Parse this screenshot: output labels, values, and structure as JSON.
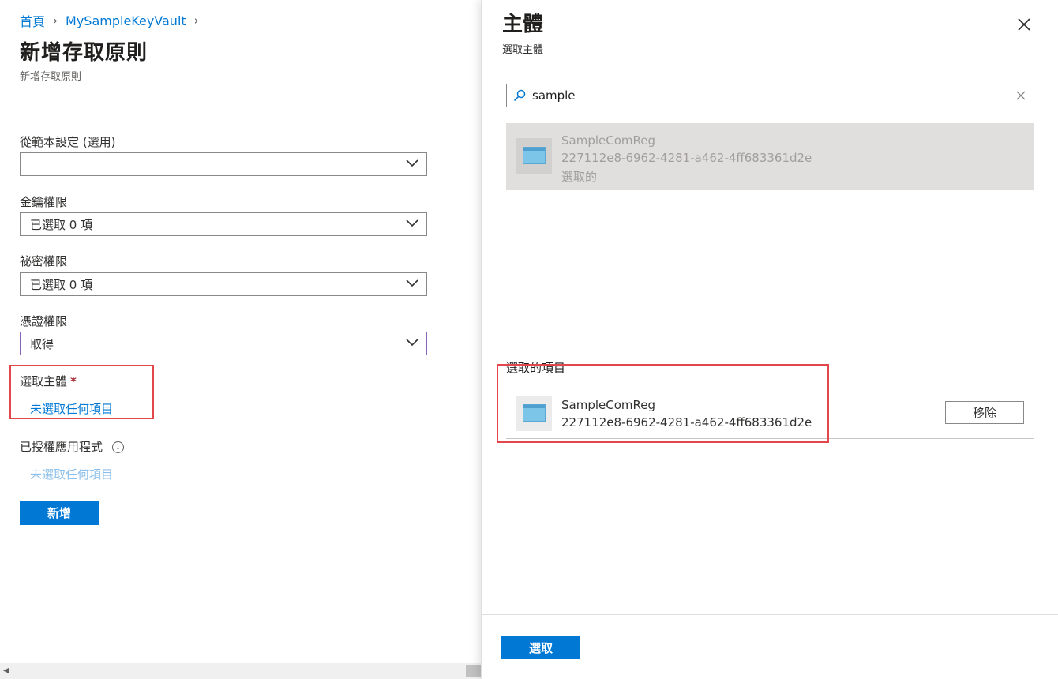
{
  "breadcrumb": {
    "home": "首頁",
    "vault": "MySampleKeyVault"
  },
  "page": {
    "title": "新增存取原則",
    "subtitle": "新增存取原則"
  },
  "form": {
    "template": {
      "label": "從範本設定 (選用)",
      "value": ""
    },
    "key_permissions": {
      "label": "金鑰權限",
      "value": "已選取 0 項"
    },
    "secret_permissions": {
      "label": "祕密權限",
      "value": "已選取 0 項"
    },
    "cert_permissions": {
      "label": "憑證權限",
      "value": "取得"
    },
    "principal": {
      "label": "選取主體",
      "required_mark": "*",
      "link": "未選取任何項目"
    },
    "authorized_app": {
      "label": "已授權應用程式",
      "info": "i",
      "link": "未選取任何項目"
    },
    "add_button": "新增"
  },
  "panel": {
    "title": "主體",
    "subtitle": "選取主體",
    "search": {
      "value": "sample"
    },
    "result": {
      "name": "SampleComReg",
      "id": "227112e8-6962-4281-a462-4ff683361d2e",
      "state": "選取的"
    },
    "selected_heading": "選取的項目",
    "selected_item": {
      "name": "SampleComReg",
      "id": "227112e8-6962-4281-a462-4ff683361d2e",
      "remove_label": "移除"
    },
    "select_button": "選取"
  },
  "colors": {
    "accent": "#0078d4",
    "highlight": "#e2474b",
    "focus_border": "#8764b8"
  },
  "icons": [
    "chevron-right-icon",
    "chevron-down-icon",
    "info-icon",
    "close-icon",
    "search-icon",
    "clear-icon",
    "app-icon",
    "scroll-left-icon"
  ]
}
